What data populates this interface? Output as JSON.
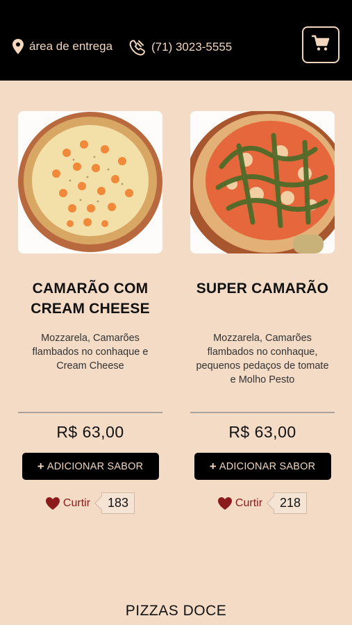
{
  "header": {
    "delivery_area_label": "área de entrega",
    "phone": "(71) 3023-5555",
    "icons": {
      "location": "map-pin-icon",
      "phone": "phone-icon",
      "cart": "shopping-cart-icon"
    }
  },
  "products": [
    {
      "name": "CAMARÃO COM CREAM CHEESE",
      "description": "Mozzarela, Camarões flambados no conhaque e Cream Cheese",
      "price": "R$ 63,00",
      "add_label": "ADICIONAR SABOR",
      "like_label": "Curtir",
      "like_count": "183"
    },
    {
      "name": "SUPER CAMARÃO",
      "description": "Mozzarela, Camarões flambados no conhaque, pequenos pedaços de tomate e Molho Pesto",
      "price": "R$ 63,00",
      "add_label": "ADICIONAR SABOR",
      "like_label": "Curtir",
      "like_count": "218"
    }
  ],
  "section": {
    "title": "PIZZAS DOCE"
  },
  "colors": {
    "accent": "#f2d6bd",
    "background": "#f3dbc6",
    "like": "#8b1a1a",
    "bar": "#000000"
  }
}
